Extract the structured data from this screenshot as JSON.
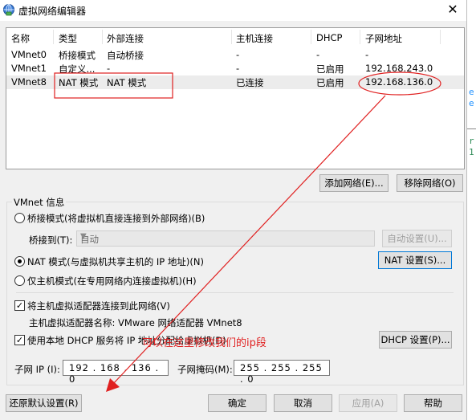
{
  "window": {
    "title": "虚拟网络编辑器",
    "close_glyph": "✕"
  },
  "table": {
    "columns": [
      "名称",
      "类型",
      "外部连接",
      "主机连接",
      "DHCP",
      "子网地址"
    ],
    "rows": [
      {
        "name": "VMnet0",
        "type": "桥接模式",
        "external": "自动桥接",
        "host": "-",
        "dhcp": "-",
        "subnet": "-"
      },
      {
        "name": "VMnet1",
        "type": "自定义...",
        "external": "-",
        "host": "-",
        "dhcp": "已启用",
        "subnet": "192.168.243.0"
      },
      {
        "name": "VMnet8",
        "type": "NAT 模式",
        "external": "NAT 模式",
        "host": "已连接",
        "dhcp": "已启用",
        "subnet": "192.168.136.0"
      }
    ]
  },
  "buttons": {
    "add_network": "添加网络(E)...",
    "remove_network": "移除网络(O)",
    "auto_settings": "自动设置(U)...",
    "nat_settings": "NAT 设置(S)...",
    "dhcp_settings": "DHCP 设置(P)...",
    "restore_defaults": "还原默认设置(R)",
    "ok": "确定",
    "cancel": "取消",
    "apply": "应用(A)",
    "help": "帮助"
  },
  "vmnet_info": {
    "group_label": "VMnet 信息",
    "bridge_mode": "桥接模式(将虚拟机直接连接到外部网络)(B)",
    "bridge_to_label": "桥接到(T):",
    "bridge_to_value": "自动",
    "nat_mode": "NAT 模式(与虚拟机共享主机的 IP 地址)(N)",
    "host_only_mode": "仅主机模式(在专用网络内连接虚拟机)(H)",
    "connect_adapter": "将主机虚拟适配器连接到此网络(V)",
    "adapter_name_label": "主机虚拟适配器名称: VMware 网络适配器 VMnet8",
    "use_dhcp": "使用本地 DHCP 服务将 IP 地址分配给虚拟机(D)",
    "subnet_ip_label": "子网 IP (I):",
    "subnet_ip_value": "192 . 168 . 136 .  0",
    "subnet_mask_label": "子网掩码(M):",
    "subnet_mask_value": "255 . 255 . 255 .  0",
    "selected_mode": "nat",
    "connect_adapter_checked": true,
    "use_dhcp_checked": true
  },
  "annotation": {
    "text": "可以在这里修改我们的ip段",
    "color": "#e02020"
  },
  "background_terminal": {
    "glyphs": [
      "e",
      "e",
      "r",
      "1"
    ],
    "colors": [
      "#1e90ff",
      "#1e90ff",
      "#2e8b57",
      "#2e8b57"
    ]
  }
}
